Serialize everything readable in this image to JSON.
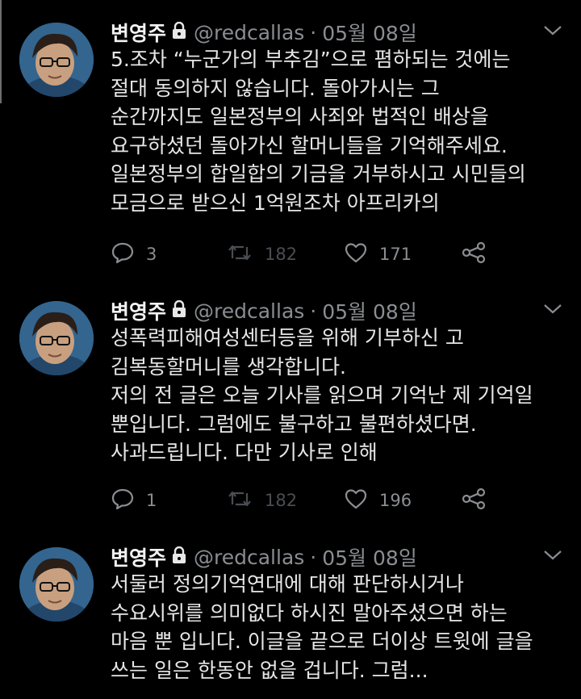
{
  "colors": {
    "background": "#000000",
    "text": "#e6e6e6",
    "muted": "#8a8d91",
    "dim": "#4a4d52"
  },
  "icons": [
    "lock-icon",
    "chevron-down-icon",
    "reply-icon",
    "retweet-icon",
    "like-icon",
    "share-icon"
  ],
  "tweets": [
    {
      "author": "변영주",
      "handle": "@redcallas",
      "separator": "·",
      "date": "05월 08일",
      "lines": [
        "5.조차 “누군가의 부추김”으로 폄하되는 것에는",
        "절대 동의하지 않습니다. 돌아가시는 그",
        "순간까지도 일본정부의 사죄와 법적인 배상을",
        "요구하셨던 돌아가신 할머니들을 기억해주세요.",
        "일본정부의 합일합의 기금을 거부하시고 시민들의",
        "모금으로 받으신 1억원조차 아프리카의"
      ],
      "replies": "3",
      "retweets": "182",
      "likes": "171"
    },
    {
      "author": "변영주",
      "handle": "@redcallas",
      "separator": "·",
      "date": "05월 08일",
      "lines": [
        "성폭력피해여성센터등을 위해 기부하신 고",
        "김복동할머니를 생각합니다.",
        "저의 전 글은 오늘 기사를 읽으며 기억난 제 기억일",
        "뿐입니다. 그럼에도 불구하고 불편하셨다면.",
        "사과드립니다. 다만 기사로 인해"
      ],
      "replies": "1",
      "retweets": "182",
      "likes": "196"
    },
    {
      "author": "변영주",
      "handle": "@redcallas",
      "separator": "·",
      "date": "05월 08일",
      "lines": [
        "서둘러 정의기억연대에 대해 판단하시거나",
        "수요시위를 의미없다 하시진 말아주셨으면 하는",
        "마음 뿐 입니다. 이글을 끝으로 더이상 트윗에 글을",
        "쓰는 일은 한동안 없을 겁니다. 그럼..."
      ]
    }
  ]
}
